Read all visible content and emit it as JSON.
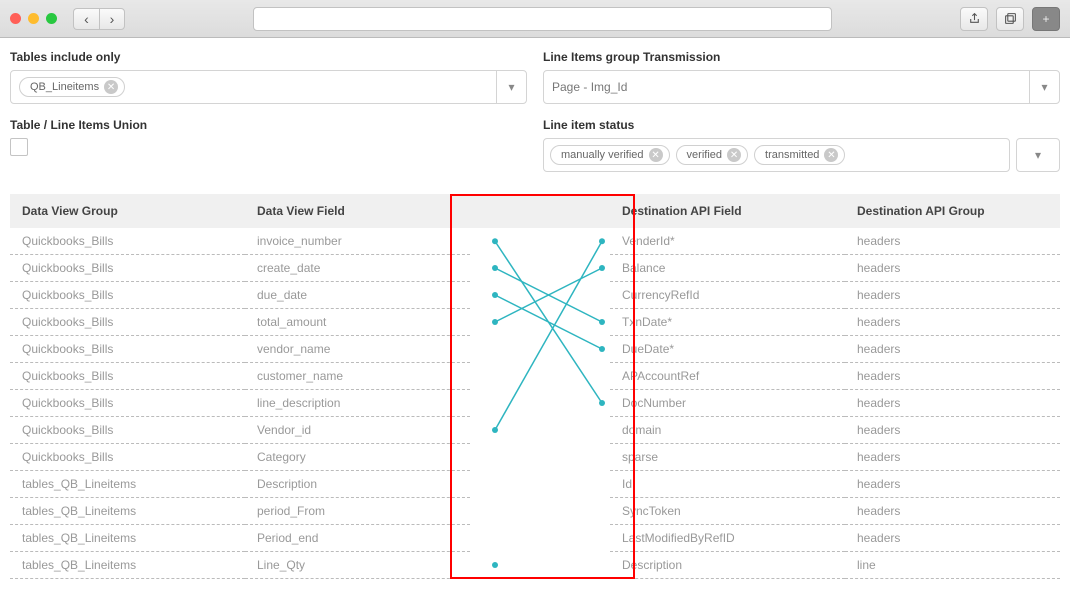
{
  "filters": {
    "tables_label": "Tables include only",
    "tables_chip": "QB_Lineitems",
    "transmission_label": "Line Items group Transmission",
    "transmission_value": "Page - Img_Id",
    "union_label": "Table / Line Items Union",
    "status_label": "Line item status",
    "status_chips": [
      "manually verified",
      "verified",
      "transmitted"
    ]
  },
  "headers": {
    "dv_group": "Data View Group",
    "dv_field": "Data View Field",
    "api_field": "Destination API Field",
    "api_group": "Destination API Group"
  },
  "left_rows": [
    {
      "group": "Quickbooks_Bills",
      "field": "invoice_number"
    },
    {
      "group": "Quickbooks_Bills",
      "field": "create_date"
    },
    {
      "group": "Quickbooks_Bills",
      "field": "due_date"
    },
    {
      "group": "Quickbooks_Bills",
      "field": "total_amount"
    },
    {
      "group": "Quickbooks_Bills",
      "field": "vendor_name"
    },
    {
      "group": "Quickbooks_Bills",
      "field": "customer_name"
    },
    {
      "group": "Quickbooks_Bills",
      "field": "line_description"
    },
    {
      "group": "Quickbooks_Bills",
      "field": "Vendor_id"
    },
    {
      "group": "Quickbooks_Bills",
      "field": "Category"
    },
    {
      "group": "tables_QB_Lineitems",
      "field": "Description"
    },
    {
      "group": "tables_QB_Lineitems",
      "field": "period_From"
    },
    {
      "group": "tables_QB_Lineitems",
      "field": "Period_end"
    },
    {
      "group": "tables_QB_Lineitems",
      "field": "Line_Qty"
    }
  ],
  "right_rows": [
    {
      "field": "VenderId*",
      "group": "headers"
    },
    {
      "field": "Balance",
      "group": "headers"
    },
    {
      "field": "CurrencyRefId",
      "group": "headers"
    },
    {
      "field": "TxnDate*",
      "group": "headers"
    },
    {
      "field": "DueDate*",
      "group": "headers"
    },
    {
      "field": "APAccountRef",
      "group": "headers"
    },
    {
      "field": "DocNumber",
      "group": "headers"
    },
    {
      "field": "domain",
      "group": "headers"
    },
    {
      "field": "sparse",
      "group": "headers"
    },
    {
      "field": "Id",
      "group": "headers"
    },
    {
      "field": "SyncToken",
      "group": "headers"
    },
    {
      "field": "LastModifiedByRefID",
      "group": "headers"
    },
    {
      "field": "Description",
      "group": "line"
    }
  ],
  "connections": [
    {
      "from": 0,
      "to": 6
    },
    {
      "from": 1,
      "to": 3
    },
    {
      "from": 2,
      "to": 4
    },
    {
      "from": 3,
      "to": 1
    },
    {
      "from": 7,
      "to": 0
    }
  ]
}
